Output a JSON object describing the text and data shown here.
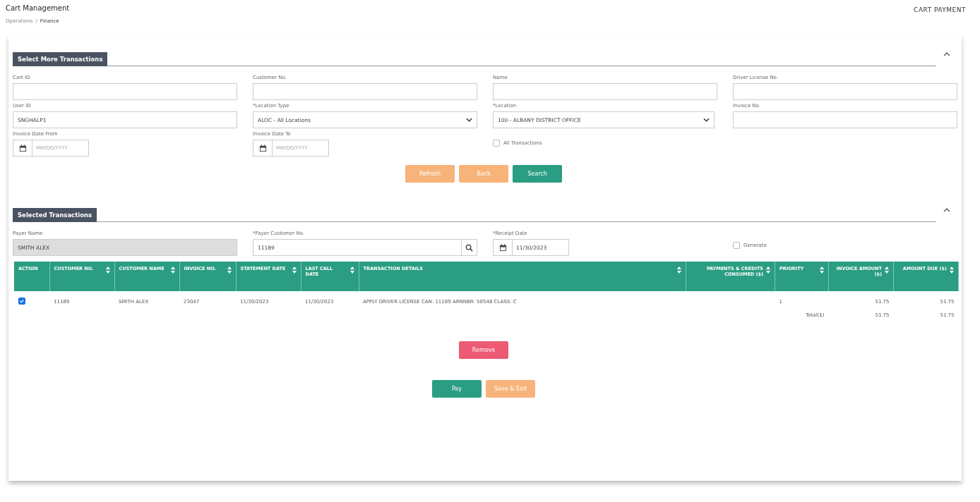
{
  "header": {
    "title": "Cart Management",
    "breadcrumb": [
      "Operations",
      "Finance"
    ],
    "breadcrumb_separator": "/",
    "page_label": "CART PAYMENT"
  },
  "search_section": {
    "title": "Select More Transactions",
    "expanded": true,
    "fields": [
      {
        "kind": "text",
        "label": "Cart ID"
      },
      {
        "kind": "text",
        "label": "Customer No."
      },
      {
        "kind": "text",
        "label": "Name"
      },
      {
        "kind": "text",
        "label": "Driver License No."
      },
      {
        "kind": "text",
        "label": "User ID",
        "value": "SNGHALP1"
      },
      {
        "kind": "select",
        "label": "*Location Type",
        "value": "ALOC - All Locations"
      },
      {
        "kind": "select",
        "label": "*Location",
        "value": "100 - ALBANY DISTRICT OFFICE"
      },
      {
        "kind": "text",
        "label": "Invoice No."
      },
      {
        "kind": "date",
        "label": "Invoice Date From",
        "placeholder": "MM/DD/YYYY"
      },
      {
        "kind": "date",
        "label": "Invoice Date To",
        "placeholder": "MM/DD/YYYY"
      },
      {
        "kind": "checkbox",
        "label": "All Transactions",
        "checked": false
      }
    ],
    "buttons": [
      {
        "label": "Refresh",
        "kind": "warning"
      },
      {
        "label": "Back",
        "kind": "warning"
      },
      {
        "label": "Search",
        "kind": "primary"
      }
    ]
  },
  "selected_section": {
    "title": "Selected Transactions",
    "expanded": true,
    "payer_name": {
      "label": "Payer Name",
      "value": "SMITH ALEX"
    },
    "payer_customer_no": {
      "label": "*Payer Customer No.",
      "value": "11189"
    },
    "receipt_date": {
      "label": "*Receipt Date",
      "value": "11/30/2023"
    },
    "generate": {
      "label": "Generate",
      "checked": false
    },
    "table": {
      "columns": [
        {
          "label": "ACTION",
          "sortable": false
        },
        {
          "label": "CUSTOMER NO.",
          "sortable": true
        },
        {
          "label": "CUSTOMER NAME",
          "sortable": true
        },
        {
          "label": "INVOICE NO.",
          "sortable": true
        },
        {
          "label": "STATEMENT DATE",
          "sortable": true
        },
        {
          "label": "LAST CALL DATE",
          "sortable": true
        },
        {
          "label": "TRANSACTION DETAILS",
          "sortable": true
        },
        {
          "label": "PAYMENTS & CREDITS CONSUMED ($)",
          "sortable": true
        },
        {
          "label": "PRIORITY",
          "sortable": true
        },
        {
          "label": "INVOICE AMOUNT ($)",
          "sortable": true
        },
        {
          "label": "AMOUNT DUE ($)",
          "sortable": true
        }
      ],
      "rows": [
        {
          "checked": true,
          "cells": [
            "",
            "11189",
            "SMITH ALEX",
            "23047",
            "11/30/2023",
            "11/30/2023",
            "APPLY DRIVER LICENSE CAN: 11189 ARNNBR: 50548 CLASS: C",
            "",
            "1",
            "51.75",
            "51.75"
          ]
        }
      ],
      "total": {
        "label": "Total($)",
        "invoice_amount": "51.75",
        "amount_due": "51.75"
      }
    },
    "remove_button": "Remove",
    "buttons": [
      {
        "label": "Pay",
        "kind": "primary"
      },
      {
        "label": "Save & Exit",
        "kind": "warning"
      }
    ]
  }
}
